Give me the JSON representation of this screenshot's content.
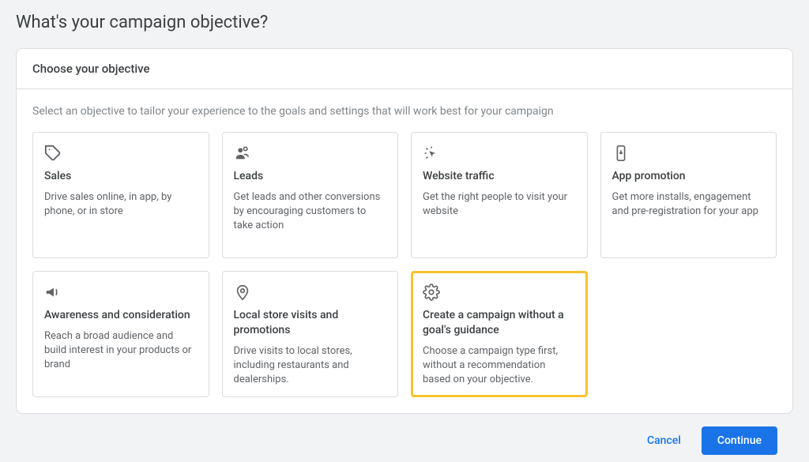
{
  "pageTitle": "What's your campaign objective?",
  "panel": {
    "heading": "Choose your objective",
    "instructions": "Select an objective to tailor your experience to the goals and settings that will work best for your campaign"
  },
  "objectives": [
    {
      "title": "Sales",
      "description": "Drive sales online, in app, by phone, or in store",
      "selected": false,
      "icon": "tag-icon"
    },
    {
      "title": "Leads",
      "description": "Get leads and other conversions by encouraging customers to take action",
      "selected": false,
      "icon": "leads-icon"
    },
    {
      "title": "Website traffic",
      "description": "Get the right people to visit your website",
      "selected": false,
      "icon": "cursor-click-icon"
    },
    {
      "title": "App promotion",
      "description": "Get more installs, engagement and pre-registration for your app",
      "selected": false,
      "icon": "app-download-icon"
    },
    {
      "title": "Awareness and consideration",
      "description": "Reach a broad audience and build interest in your products or brand",
      "selected": false,
      "icon": "megaphone-icon"
    },
    {
      "title": "Local store visits and promotions",
      "description": "Drive visits to local stores, including restaurants and dealerships.",
      "selected": false,
      "icon": "pin-icon"
    },
    {
      "title": "Create a campaign without a goal's guidance",
      "description": "Choose a campaign type first, without a recommendation based on your objective.",
      "selected": true,
      "icon": "gear-icon"
    }
  ],
  "buttons": {
    "cancel": "Cancel",
    "continue": "Continue"
  }
}
